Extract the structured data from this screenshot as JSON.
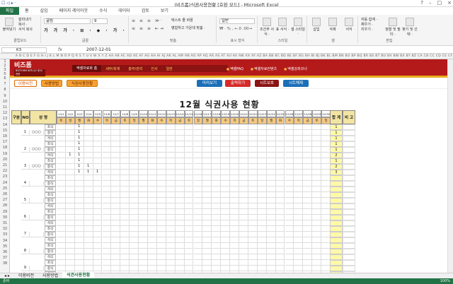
{
  "titlebar": {
    "title": "(비즈폼)식권사용현황 [호환 모드] - Microsoft Excel",
    "qat": "☐ ◁ ▸ ·"
  },
  "ribbon_tabs": [
    "파일",
    "홈",
    "삽입",
    "페이지 레이아웃",
    "수식",
    "데이터",
    "검토",
    "보기"
  ],
  "ribbon": {
    "clipboard": {
      "paste": "붙여넣기",
      "cut": "잘라내기",
      "copy": "복사 ·",
      "format_painter": "서식 복사",
      "label": "클립보드"
    },
    "font": {
      "name": "굴림",
      "size": "9",
      "label": "글꼴"
    },
    "align": {
      "wrap": "텍스트 줄 바꿈",
      "merge": "병합하고 가운데 맞춤 ·",
      "label": "맞춤"
    },
    "number": {
      "format": "일반",
      "label": "표시 형식"
    },
    "styles": {
      "cond": "조건부 서식 ·",
      "table": "표 서식 ·",
      "cell": "셀 스타일 ·",
      "label": "스타일"
    },
    "cells": {
      "insert": "삽입",
      "delete": "삭제",
      "format": "서식",
      "label": "셀"
    },
    "editing": {
      "autosum": "자동 합계 ·",
      "fill": "채우기 ·",
      "clear": "지우기 ·",
      "sort": "정렬 및 필터 ·",
      "find": "찾기 및 선택 ·",
      "label": "편집"
    }
  },
  "formula_bar": {
    "cell": "K3",
    "fx": "fx",
    "value": "2007-12-01"
  },
  "col_headers": "A B C D E F G H I J K L M N O P Q R S T U V W X Y Z AA AB AC AD AE AF AG AH AI AJ AK AL AM AN AO AP AQ AR AS AT AU AV AW AX AY AZ BA BB BC BD BE BF BG BH BI BJ BK BL BM BN BO BP BQ BR BS BT BU BV BW BX BY BZ CA CB CC CD CE CF CG CH CI CJ CK CL CM",
  "row_numbers": [
    "1",
    "2",
    "3",
    "5",
    "6",
    "7",
    "8",
    "9",
    "10",
    "11",
    "12",
    "13",
    "14",
    "15",
    "16",
    "17",
    "18",
    "19",
    "20",
    "21",
    "22",
    "23",
    "24",
    "25",
    "26",
    "27",
    "28",
    "29",
    "30",
    "31",
    "32",
    "33",
    "34",
    "35",
    "36",
    "37",
    "38"
  ],
  "banner": {
    "logo": "비즈폼",
    "logo_sub": "BIZFORM 비즈니스 문서 전문",
    "menu": [
      "엑셀자료화 홈",
      "세무/회계",
      "총무/관리",
      "인사",
      "일반"
    ],
    "right_menu": [
      "엑셀FAQ",
      "엑셀자료컨텐츠",
      "엑셀강좌코너"
    ]
  },
  "subbar": {
    "btn1": "이용비전",
    "btn2": "사용방법",
    "btn3": "식권사용현황",
    "btn4": "미리보기",
    "btn5": "출력하기",
    "btn6": "시트보호",
    "btn7": "시트해제"
  },
  "sheet": {
    "title": "12월 식권사용 현황",
    "hdr_gubun": "구분",
    "hdr_no": "NO",
    "hdr_name": "성 명",
    "hdr_total": "합 계",
    "hdr_remark": "비 고",
    "dates": [
      "12/1",
      "12/2",
      "12/3",
      "12/4",
      "12/5",
      "12/6",
      "12/7",
      "12/8",
      "12/9",
      "12/10",
      "12/11",
      "12/12",
      "12/13",
      "12/14",
      "12/15",
      "12/16",
      "12/17",
      "12/18",
      "12/19",
      "12/20",
      "12/21",
      "12/22",
      "12/23",
      "12/24",
      "12/25",
      "12/26",
      "12/27",
      "12/28",
      "12/29",
      "12/30",
      "12/31"
    ],
    "weekdays": [
      "토",
      "일",
      "월",
      "화",
      "수",
      "목",
      "금",
      "토",
      "일",
      "월",
      "화",
      "수",
      "목",
      "금",
      "토",
      "일",
      "월",
      "화",
      "수",
      "목",
      "금",
      "토",
      "일",
      "월",
      "화",
      "수",
      "목",
      "금",
      "토",
      "일",
      "월"
    ],
    "meals": [
      "조식",
      "중식",
      "석식"
    ],
    "people": [
      {
        "no": "1",
        "name": "○○○",
        "marks": [
          [
            "",
            "",
            "1"
          ],
          [
            "",
            "",
            "1"
          ],
          [
            "",
            "",
            "1"
          ]
        ],
        "totals": [
          "1",
          "1",
          "1"
        ]
      },
      {
        "no": "2",
        "name": "○○○",
        "marks": [
          [
            "",
            "",
            "1"
          ],
          [
            "",
            "",
            "1"
          ],
          [
            "",
            "1",
            "1"
          ]
        ],
        "totals": [
          "1",
          "1",
          "2"
        ]
      },
      {
        "no": "3",
        "name": "○○○",
        "marks": [
          [
            "",
            "",
            "1"
          ],
          [
            "",
            "",
            "1",
            "1"
          ],
          [
            "",
            "",
            "1",
            "1",
            "1"
          ]
        ],
        "totals": [
          "1",
          "2",
          "3"
        ]
      },
      {
        "no": "4",
        "name": "",
        "marks": [
          [],
          [],
          []
        ],
        "totals": [
          "",
          "",
          ""
        ]
      },
      {
        "no": "5",
        "name": "",
        "marks": [
          [],
          [],
          []
        ],
        "totals": [
          "",
          "",
          ""
        ]
      },
      {
        "no": "6",
        "name": "",
        "marks": [
          [],
          [],
          []
        ],
        "totals": [
          "",
          "",
          ""
        ]
      },
      {
        "no": "7",
        "name": "",
        "marks": [
          [],
          [],
          []
        ],
        "totals": [
          "",
          "",
          ""
        ]
      },
      {
        "no": "8",
        "name": "",
        "marks": [
          [],
          [],
          []
        ],
        "totals": [
          "",
          "",
          ""
        ]
      },
      {
        "no": "9",
        "name": "",
        "marks": [
          [],
          [],
          []
        ],
        "totals": [
          "",
          "",
          ""
        ]
      }
    ]
  },
  "sheet_tabs": [
    "이용비전",
    "사용방법",
    "식권사용현황"
  ],
  "status": {
    "left": "준비",
    "right": "100%"
  }
}
